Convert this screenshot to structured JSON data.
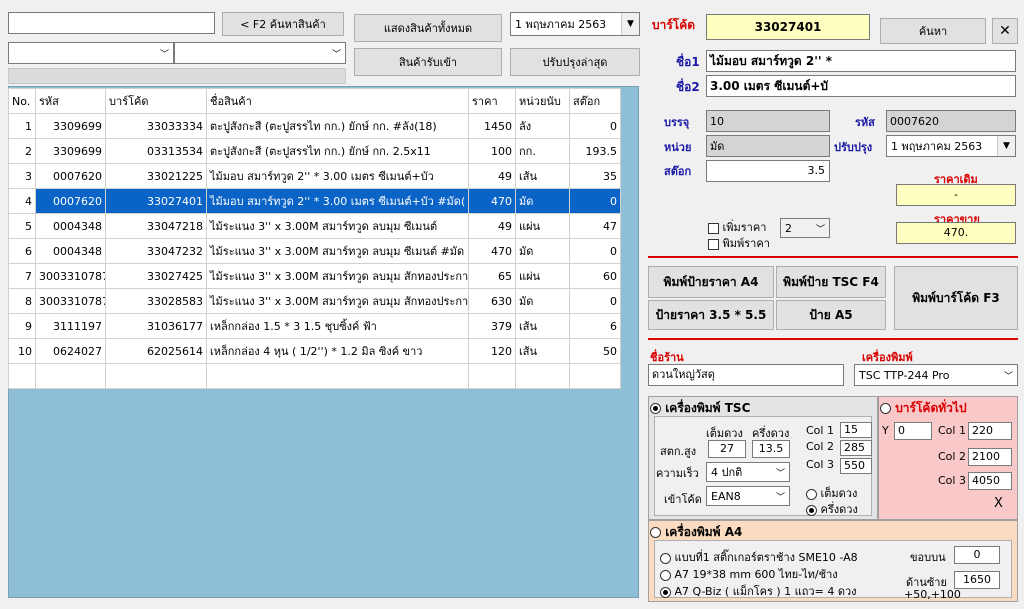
{
  "search": {
    "value": "",
    "button": "< F2 ค้นหาสินค้า"
  },
  "filters": {
    "combo1": "",
    "combo2": ""
  },
  "buttons": {
    "show_all": "แสดงสินค้าทั้งหมด",
    "received": "สินค้ารับเข้า",
    "latest": "ปรับปรุงล่าสุด"
  },
  "date_top": "1  พฤษภาคม  2563",
  "table": {
    "headers": [
      "No.",
      "รหัส",
      "บาร์โค้ด",
      "ชื่อสินค้า",
      "ราคา",
      "หน่วยนับ",
      "สต๊อก"
    ],
    "rows": [
      [
        "1",
        "3309699",
        "33033334",
        "ตะปูสังกะสี (ตะปูสรรไท กก.) ยักษ์ กก.  #ลัง(18)",
        "1450",
        "ลัง",
        "0"
      ],
      [
        "2",
        "3309699",
        "03313534",
        "ตะปูสังกะสี (ตะปูสรรไท กก.) ยักษ์ กก. 2.5x11",
        "100",
        "กก.",
        "193.5"
      ],
      [
        "3",
        "0007620",
        "33021225",
        "ไม้มอบ สมาร์ทวูด 2'' * 3.00 เมตร  ซีเมนต์+บัว",
        "49",
        "เส้น",
        "35"
      ],
      [
        "4",
        "0007620",
        "33027401",
        "ไม้มอบ สมาร์ทวูด 2'' * 3.00 เมตร  ซีเมนต์+บัว  #มัด(",
        "470",
        "มัด",
        "0"
      ],
      [
        "5",
        "0004348",
        "33047218",
        "ไม้ระแนง 3'' x 3.00M สมาร์ทวูด ลบมุม ซีเมนต์",
        "49",
        "แผ่น",
        "47"
      ],
      [
        "6",
        "0004348",
        "33047232",
        "ไม้ระแนง 3'' x 3.00M สมาร์ทวูด ลบมุม ซีเมนต์  #มัด",
        "470",
        "มัด",
        "0"
      ],
      [
        "7",
        "3003310787",
        "33027425",
        "ไม้ระแนง 3'' x 3.00M สมาร์ทวูด ลบมุม สักทองประกา",
        "65",
        "แผ่น",
        "60"
      ],
      [
        "8",
        "3003310787",
        "33028583",
        "ไม้ระแนง 3'' x 3.00M สมาร์ทวูด ลบมุม สักทองประกา",
        "630",
        "มัด",
        "0"
      ],
      [
        "9",
        "3111197",
        "31036177",
        "เหล็กกล่อง 1.5 * 3  1.5 ชุบซิ้งค์  ฟ้า",
        "379",
        "เส้น",
        "6"
      ],
      [
        "10",
        "0624027",
        "62025614",
        "เหล็กกล่อง 4 หุน ( 1/2'') * 1.2 มิล ซิงค์  ขาว",
        "120",
        "เส้น",
        "50"
      ]
    ]
  },
  "detail": {
    "barcode_label": "บาร์โค้ด",
    "barcode_value": "33027401",
    "search_btn": "ค้นหา",
    "close": "✕",
    "name1_label": "ชื่อ1",
    "name1_value": "ไม้มอบ สมาร์ทวูด 2'' *",
    "name2_label": "ชื่อ2",
    "name2_value": "3.00 เมตร  ซีเมนต์+บั",
    "pack_label": "บรรจุ",
    "pack_value": "10",
    "code_label": "รหัส",
    "code_value": "0007620",
    "unit_label": "หน่วย",
    "unit_value": "มัด",
    "update_label": "ปรับปรุง",
    "update_date": "1  พฤษภาคม  2563",
    "stock_label": "สต๊อก",
    "stock_value": "3.5",
    "old_price_label": "ราคาเดิม",
    "old_price_value": "-",
    "sell_price_label": "ราคาขาย",
    "sell_price_value": "470.",
    "add_price_label": "เพิ่มราคา",
    "print_price_label": "พิมพ์ราคา",
    "qty_value": "2"
  },
  "print_buttons": {
    "a4": "พิมพ์ป้ายราคา A4",
    "tsc": "พิมพ์ป้าย TSC F4",
    "barcode": "พิมพ์บาร์โค้ด F3",
    "p35": "ป้ายราคา 3.5 * 5.5",
    "a5": "ป้าย A5"
  },
  "shop": {
    "label": "ชื่อร้าน",
    "value": "ดวนใหญ่วัสดุ"
  },
  "printer": {
    "label": "เครื่องพิมพ์",
    "value": "TSC TTP-244 Pro"
  },
  "tsc": {
    "title": "เครื่องพิมพ์  TSC",
    "full": "เต็มดวง",
    "half": "ครึ่งดวง",
    "height_label": "สตก.สูง",
    "height_full": "27",
    "height_half": "13.5",
    "speed_label": "ความเร็ว",
    "speed_value": "4 ปกติ",
    "barcode_label": "เข้าโค้ด",
    "barcode_value": "EAN8",
    "col1_label": "Col 1",
    "col1_value": "15",
    "col2_label": "Col 2",
    "col2_value": "285",
    "col3_label": "Col 3",
    "col3_value": "550",
    "opt_full": "เต็มดวง",
    "opt_half": "ครึ่งดวง"
  },
  "general": {
    "title": "บาร์โค้ดทั่วไป",
    "y_label": "Y",
    "y_value": "0",
    "col1_label": "Col 1",
    "col1_value": "220",
    "col2_label": "Col 2",
    "col2_value": "2100",
    "col3_label": "Col 3",
    "col3_value": "4050",
    "x": "X"
  },
  "a4": {
    "title": "เครื่องพิมพ์ A4",
    "opt1": "แบบที่1 สติ๊กเกอร์ตราช้าง SME10 -A8",
    "opt2": "A7 19*38 mm 600 ไทย-ไท/ช้าง",
    "opt3": "A7 Q-Biz ( แม็กโคร ) 1 แถว= 4 ดวง",
    "top_label": "ขอบบน",
    "top_value": "0",
    "left_label": "ด้านซ้าย",
    "left_value": "1650",
    "hint": "+50,+100"
  },
  "colors": {
    "selection": "#0a64c8",
    "barcode_bg": "#ffffc0",
    "grid_bg": "#8fbfd6",
    "red": "#d80000",
    "blue": "#1a1aa6",
    "pink": "#f9c8c8",
    "peach": "#fbdcc0"
  }
}
